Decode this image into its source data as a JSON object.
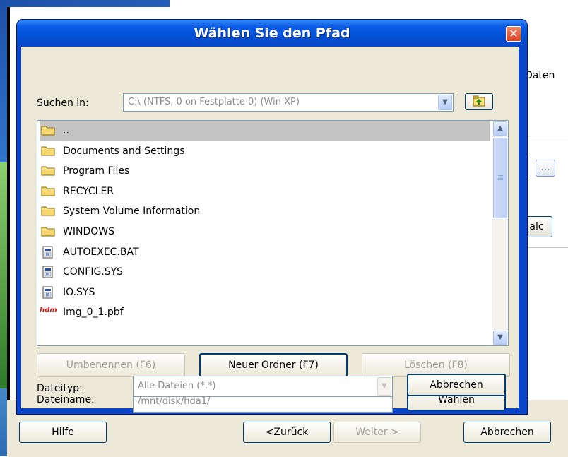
{
  "background": {
    "side_text": "Daten",
    "dots_button": "...",
    "calc_button": "alc",
    "footer": {
      "help": "Hilfe",
      "back": "<Zurück",
      "next": "Weiter >",
      "cancel": "Abbrechen"
    }
  },
  "dialog": {
    "title": "Wählen Sie den Pfad",
    "look_in": {
      "label": "Suchen in:",
      "value": "C:\\ (NTFS, 0 on Festplatte 0) (Win XP)"
    },
    "files": [
      {
        "name": "..",
        "type": "folder",
        "selected": true
      },
      {
        "name": "Documents and Settings",
        "type": "folder"
      },
      {
        "name": "Program Files",
        "type": "folder"
      },
      {
        "name": "RECYCLER",
        "type": "folder"
      },
      {
        "name": "System Volume Information",
        "type": "folder"
      },
      {
        "name": "WINDOWS",
        "type": "folder"
      },
      {
        "name": "AUTOEXEC.BAT",
        "type": "system-file"
      },
      {
        "name": "CONFIG.SYS",
        "type": "system-file"
      },
      {
        "name": "IO.SYS",
        "type": "system-file"
      },
      {
        "name": "Img_0_1.pbf",
        "type": "image-file",
        "icon_text": "hdm"
      }
    ],
    "buttons": {
      "rename": "Umbenennen (F6)",
      "new_folder": "Neuer Ordner (F7)",
      "delete": "Löschen (F8)",
      "choose": "Wählen",
      "cancel": "Abbrechen"
    },
    "filename": {
      "label": "Dateiname:",
      "value": "/mnt/disk/hda1/"
    },
    "filetype": {
      "label": "Dateityp:",
      "value": "Alle Dateien (*.*)"
    }
  },
  "colors": {
    "title_bar": "#0a5ce6",
    "dialog_face": "#ece9d8",
    "selection": "#c4c4c4",
    "close_button": "#d8401c"
  }
}
